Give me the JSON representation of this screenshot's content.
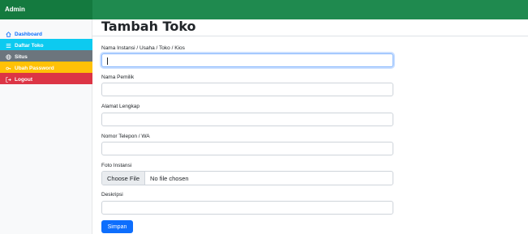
{
  "app": {
    "brand": "Admin"
  },
  "sidebar": {
    "items": [
      {
        "label": "Dashboard",
        "icon": "home-icon"
      },
      {
        "label": "Daftar Toko",
        "icon": "list-icon"
      },
      {
        "label": "Situs",
        "icon": "globe-icon"
      },
      {
        "label": "Ubah Password",
        "icon": "key-icon"
      },
      {
        "label": "Logout",
        "icon": "logout-icon"
      }
    ]
  },
  "page": {
    "title": "Tambah Toko"
  },
  "form": {
    "nama_instansi": {
      "label": "Nama Instansi / Usaha / Toko / Kios",
      "value": ""
    },
    "nama_pemilik": {
      "label": "Nama Pemilik",
      "value": ""
    },
    "alamat": {
      "label": "Alamat Lengkap",
      "value": ""
    },
    "telepon": {
      "label": "Nomor Telepon / WA",
      "value": ""
    },
    "foto": {
      "label": "Foto Instansi",
      "button": "Choose File",
      "status": "No file chosen"
    },
    "deskripsi": {
      "label": "Deskripsi",
      "value": ""
    },
    "submit_label": "Simpan"
  },
  "colors": {
    "topbar": "#1f8a4f",
    "primary": "#0d6efd",
    "info": "#0dcaf0",
    "secondary": "#6c757d",
    "warning": "#ffc107",
    "danger": "#dc3545"
  }
}
